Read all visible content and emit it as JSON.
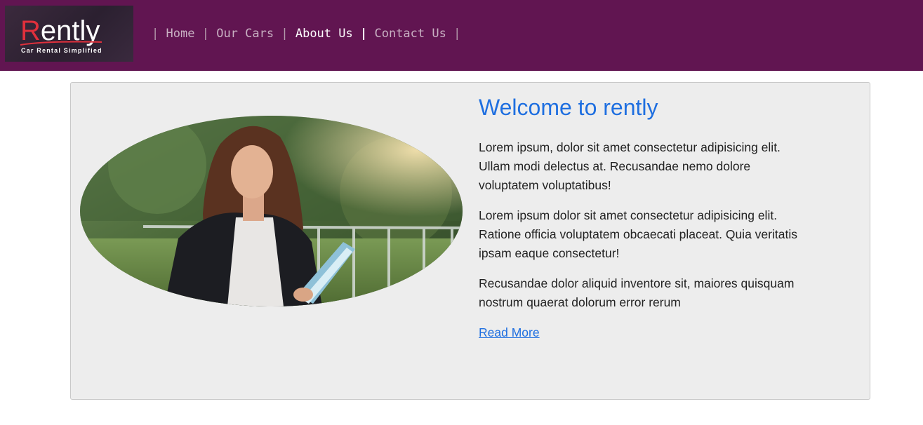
{
  "brand": {
    "name": "Rently",
    "tagline": "Car Rental Simplified"
  },
  "nav": {
    "items": [
      {
        "label": "Home",
        "active": false
      },
      {
        "label": "Our Cars",
        "active": false
      },
      {
        "label": "About Us",
        "active": true
      },
      {
        "label": "Contact Us",
        "active": false
      }
    ],
    "separator": "|"
  },
  "about": {
    "title": "Welcome to rently",
    "paragraphs": [
      "Lorem ipsum, dolor sit amet consectetur adipisicing elit. Ullam modi delectus at. Recusandae nemo dolore voluptatem voluptatibus!",
      "Lorem ipsum dolor sit amet consectetur adipisicing elit. Ratione officia voluptatem obcaecati placeat. Quia veritatis ipsam eaque consectetur!",
      "Recusandae dolor aliquid inventore sit, maiores quisquam nostrum quaerat dolorum error rerum"
    ],
    "read_more": "Read More"
  },
  "colors": {
    "navbar_bg": "#611551",
    "accent_blue": "#1f6fe0",
    "card_bg": "#ededed",
    "logo_red": "#e0303c"
  }
}
